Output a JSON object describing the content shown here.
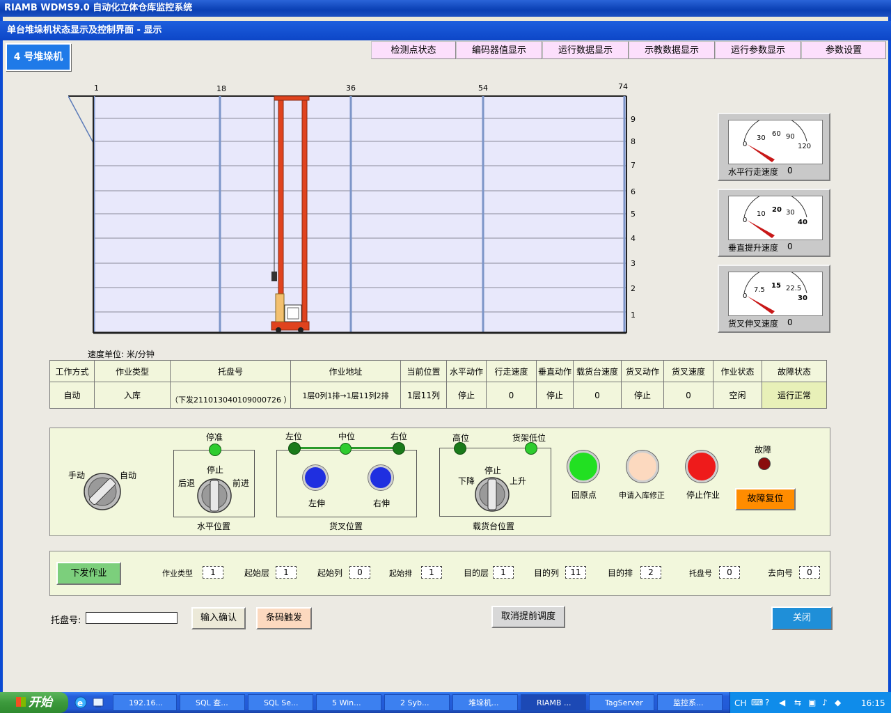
{
  "app_title": "RIAMB WDMS9.0 自动化立体仓库监控系统",
  "window_title": "单台堆垛机状态显示及控制界面 - 显示",
  "crane_label": "4 号堆垛机",
  "tabs": [
    "检测点状态",
    "编码器值显示",
    "运行数据显示",
    "示教数据显示",
    "运行参数显示",
    "参数设置"
  ],
  "rack": {
    "column_labels": [
      "1",
      "18",
      "36",
      "54",
      "74"
    ],
    "layer_labels": [
      "9",
      "8",
      "7",
      "6",
      "5",
      "4",
      "3",
      "2",
      "1"
    ]
  },
  "gauges": [
    {
      "label": "水平行走速度",
      "value": "0",
      "ticks": [
        "0",
        "30",
        "60",
        "90",
        "120"
      ]
    },
    {
      "label": "垂直提升速度",
      "value": "0",
      "ticks": [
        "0",
        "10",
        "20",
        "30",
        "40"
      ]
    },
    {
      "label": "货叉伸叉速度",
      "value": "0",
      "ticks": [
        "0",
        "7.5",
        "15",
        "22.5",
        "30"
      ]
    }
  ],
  "speed_unit": "速度单位: 米/分钟",
  "status_table": {
    "headers": [
      "工作方式",
      "作业类型",
      "托盘号",
      "作业地址",
      "当前位置",
      "水平动作",
      "行走速度",
      "垂直动作",
      "载货台速度",
      "货叉动作",
      "货叉速度",
      "作业状态",
      "故障状态"
    ],
    "values": [
      "自动",
      "入库",
      "（下发211013040109000726 ）",
      "1层0列1排→1层11列2排",
      "1层11列",
      "停止",
      "0",
      "停止",
      "0",
      "停止",
      "0",
      "空闲",
      "运行正常"
    ]
  },
  "control": {
    "mode": {
      "manual": "手动",
      "auto": "自动"
    },
    "horizontal": {
      "stop_ok": "停准",
      "stop": "停止",
      "back": "后退",
      "forward": "前进",
      "title": "水平位置"
    },
    "fork": {
      "left": "左位",
      "middle": "中位",
      "right": "右位",
      "left_ext": "左伸",
      "right_ext": "右伸",
      "title": "货叉位置"
    },
    "carrier": {
      "high": "高位",
      "rack_low": "货架低位",
      "stop": "停止",
      "down": "下降",
      "up": "上升",
      "title": "载货台位置"
    },
    "return_home": "回原点",
    "request_fix": "申请入库修正",
    "stop_job": "停止作业",
    "fault": "故障",
    "fault_reset": "故障复位"
  },
  "dispatch": {
    "button": "下发作业",
    "fields": [
      {
        "label": "作业类型",
        "value": "1"
      },
      {
        "label": "起始层",
        "value": "1"
      },
      {
        "label": "起始列",
        "value": "0"
      },
      {
        "label": "起始排",
        "value": "1"
      },
      {
        "label": "目的层",
        "value": "1"
      },
      {
        "label": "目的列",
        "value": "11"
      },
      {
        "label": "目的排",
        "value": "2"
      },
      {
        "label": "托盘号",
        "value": "0"
      },
      {
        "label": "去向号",
        "value": "0"
      }
    ]
  },
  "bottom": {
    "pallet_label": "托盘号:",
    "pallet_value": "",
    "confirm": "输入确认",
    "barcode": "条码触发",
    "cancel": "取消提前调度",
    "close": "关闭"
  },
  "taskbar": {
    "start": "开始",
    "tasks": [
      "192.16...",
      "SQL 查...",
      "SQL Se...",
      "5 Win...",
      "2 Syb...",
      "堆垛机...",
      "RIAMB ...",
      "TagServer",
      "监控系..."
    ],
    "lang": "CH",
    "clock": "16:15"
  },
  "colors": {
    "rack_bg": "#e8e8fb",
    "crane_red": "#e0431e",
    "panel_bg": "#f2f7dc",
    "tab_bg": "#fcdffc",
    "fault_reset": "#ff8c00",
    "close_btn": "#1f8fd8",
    "dispatch_btn": "#7ccf7c"
  }
}
